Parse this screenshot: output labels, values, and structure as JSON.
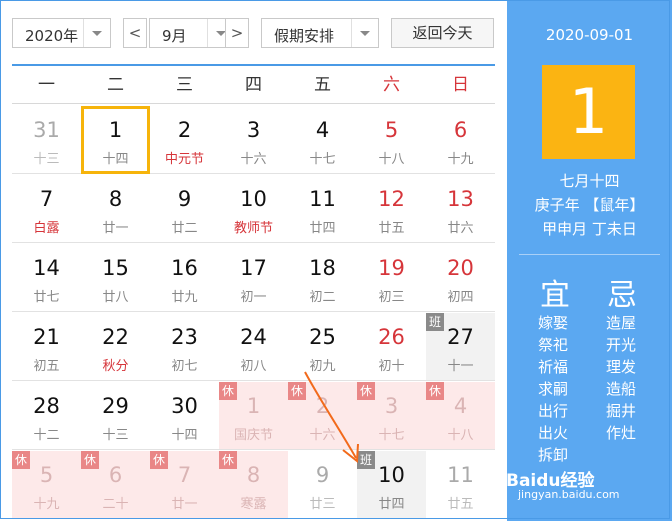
{
  "toolbar": {
    "year": "2020年",
    "prev": "<",
    "month": "9月",
    "next": ">",
    "holiday": "假期安排",
    "today": "返回今天"
  },
  "weekdays": [
    "一",
    "二",
    "三",
    "四",
    "五",
    "六",
    "日"
  ],
  "rows": [
    [
      {
        "d": "31",
        "l": "十三",
        "kind": "other"
      },
      {
        "d": "1",
        "l": "十四",
        "kind": "selected"
      },
      {
        "d": "2",
        "l": "中元节",
        "kind": "festival"
      },
      {
        "d": "3",
        "l": "十六"
      },
      {
        "d": "4",
        "l": "十七"
      },
      {
        "d": "5",
        "l": "十八",
        "kind": "weekend"
      },
      {
        "d": "6",
        "l": "十九",
        "kind": "weekend"
      }
    ],
    [
      {
        "d": "7",
        "l": "白露",
        "kind": "festival"
      },
      {
        "d": "8",
        "l": "廿一"
      },
      {
        "d": "9",
        "l": "廿二"
      },
      {
        "d": "10",
        "l": "教师节",
        "kind": "festival"
      },
      {
        "d": "11",
        "l": "廿四"
      },
      {
        "d": "12",
        "l": "廿五",
        "kind": "weekend"
      },
      {
        "d": "13",
        "l": "廿六",
        "kind": "weekend"
      }
    ],
    [
      {
        "d": "14",
        "l": "廿七"
      },
      {
        "d": "15",
        "l": "廿八"
      },
      {
        "d": "16",
        "l": "廿九"
      },
      {
        "d": "17",
        "l": "初一"
      },
      {
        "d": "18",
        "l": "初二"
      },
      {
        "d": "19",
        "l": "初三",
        "kind": "weekend"
      },
      {
        "d": "20",
        "l": "初四",
        "kind": "weekend"
      }
    ],
    [
      {
        "d": "21",
        "l": "初五"
      },
      {
        "d": "22",
        "l": "秋分",
        "kind": "festival"
      },
      {
        "d": "23",
        "l": "初七"
      },
      {
        "d": "24",
        "l": "初八"
      },
      {
        "d": "25",
        "l": "初九"
      },
      {
        "d": "26",
        "l": "初十",
        "kind": "weekend"
      },
      {
        "d": "27",
        "l": "十一",
        "kind": "work",
        "badge": "班"
      }
    ],
    [
      {
        "d": "28",
        "l": "十二"
      },
      {
        "d": "29",
        "l": "十三"
      },
      {
        "d": "30",
        "l": "十四"
      },
      {
        "d": "1",
        "l": "国庆节",
        "kind": "rest",
        "badge": "休"
      },
      {
        "d": "2",
        "l": "十六",
        "kind": "rest",
        "badge": "休"
      },
      {
        "d": "3",
        "l": "十七",
        "kind": "rest",
        "badge": "休"
      },
      {
        "d": "4",
        "l": "十八",
        "kind": "rest",
        "badge": "休"
      }
    ],
    [
      {
        "d": "5",
        "l": "十九",
        "kind": "rest",
        "badge": "休"
      },
      {
        "d": "6",
        "l": "二十",
        "kind": "rest",
        "badge": "休"
      },
      {
        "d": "7",
        "l": "廿一",
        "kind": "rest",
        "badge": "休"
      },
      {
        "d": "8",
        "l": "寒露",
        "kind": "rest",
        "badge": "休"
      },
      {
        "d": "9",
        "l": "廿三",
        "kind": "other"
      },
      {
        "d": "10",
        "l": "廿四",
        "kind": "work",
        "badge": "班"
      },
      {
        "d": "11",
        "l": "廿五",
        "kind": "other"
      }
    ]
  ],
  "side": {
    "date": "2020-09-01",
    "day": "1",
    "lunar": "七月十四",
    "year_gz": "庚子年 【鼠年】",
    "month_day_gz": "甲申月 丁未日",
    "yi_title": "宜",
    "ji_title": "忌",
    "yi": [
      "嫁娶",
      "祭祀",
      "祈福",
      "求嗣",
      "出行",
      "出火",
      "拆卸"
    ],
    "ji": [
      "造屋",
      "开光",
      "理发",
      "造船",
      "掘井",
      "作灶"
    ]
  },
  "watermark": {
    "brand": "Baidu经验",
    "url": "jingyan.baidu.com"
  },
  "colors": {
    "accent": "#5ba8f1",
    "selected_border": "#f6b40b",
    "holiday_red": "#d6353a",
    "rest_bg": "#fde9e9"
  }
}
